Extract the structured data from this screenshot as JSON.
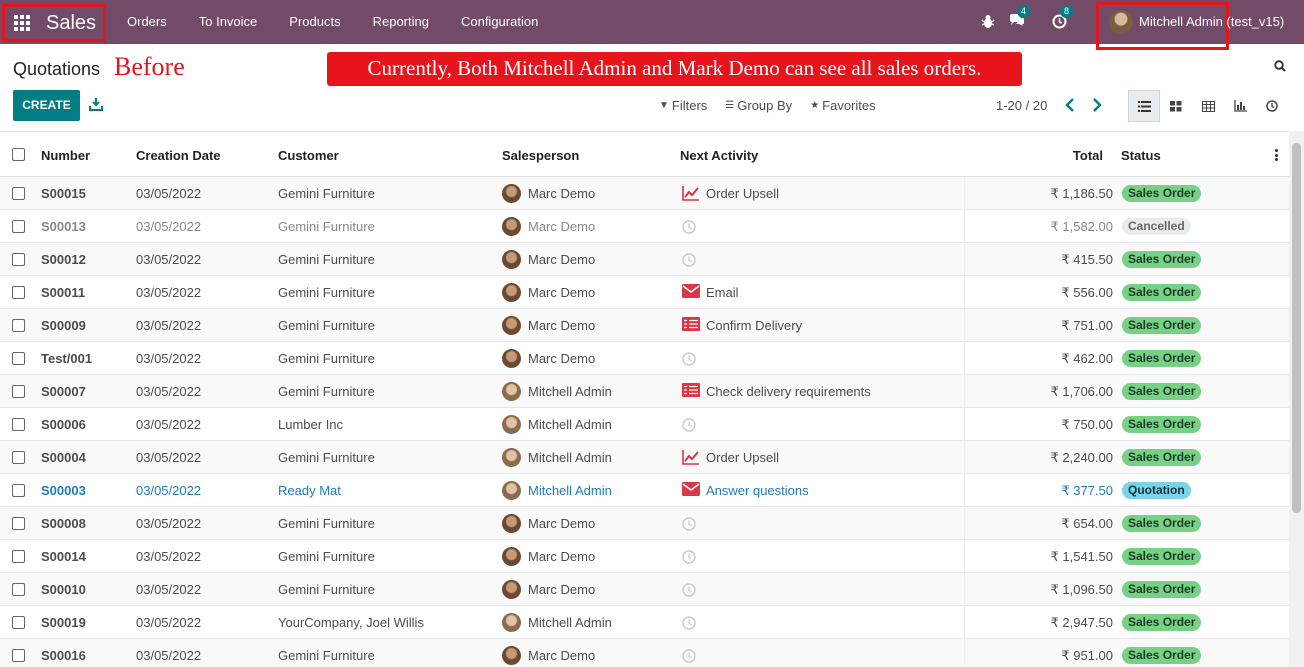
{
  "navbar": {
    "brand": "Sales",
    "menu": [
      "Orders",
      "To Invoice",
      "Products",
      "Reporting",
      "Configuration"
    ],
    "messages_count": "4",
    "activities_count": "8",
    "user": "Mitchell Admin (test_v15)"
  },
  "control_panel": {
    "title": "Quotations",
    "annotation_label": "Before",
    "banner": "Currently, Both Mitchell Admin and Mark Demo can see all sales orders.",
    "create_label": "CREATE",
    "filters_label": "Filters",
    "group_by_label": "Group By",
    "favorites_label": "Favorites",
    "pager": "1-20 / 20"
  },
  "table": {
    "headers": {
      "number": "Number",
      "creation_date": "Creation Date",
      "customer": "Customer",
      "salesperson": "Salesperson",
      "next_activity": "Next Activity",
      "total": "Total",
      "status": "Status"
    },
    "rows": [
      {
        "number": "S00015",
        "date": "03/05/2022",
        "customer": "Gemini Furniture",
        "salesperson": "Marc Demo",
        "activity": "Order Upsell",
        "activity_icon": "trend-icon",
        "total": "₹ 1,186.50",
        "status": "Sales Order",
        "kind": "sale"
      },
      {
        "number": "S00013",
        "date": "03/05/2022",
        "customer": "Gemini Furniture",
        "salesperson": "Marc Demo",
        "activity": "",
        "activity_icon": "clock-icon",
        "total": "₹ 1,582.00",
        "status": "Cancelled",
        "kind": "cancel"
      },
      {
        "number": "S00012",
        "date": "03/05/2022",
        "customer": "Gemini Furniture",
        "salesperson": "Marc Demo",
        "activity": "",
        "activity_icon": "clock-icon",
        "total": "₹ 415.50",
        "status": "Sales Order",
        "kind": "sale"
      },
      {
        "number": "S00011",
        "date": "03/05/2022",
        "customer": "Gemini Furniture",
        "salesperson": "Marc Demo",
        "activity": "Email",
        "activity_icon": "envelope-icon",
        "total": "₹ 556.00",
        "status": "Sales Order",
        "kind": "sale"
      },
      {
        "number": "S00009",
        "date": "03/05/2022",
        "customer": "Gemini Furniture",
        "salesperson": "Marc Demo",
        "activity": "Confirm Delivery",
        "activity_icon": "tasks-icon",
        "total": "₹ 751.00",
        "status": "Sales Order",
        "kind": "sale"
      },
      {
        "number": "Test/001",
        "date": "03/05/2022",
        "customer": "Gemini Furniture",
        "salesperson": "Marc Demo",
        "activity": "",
        "activity_icon": "clock-icon",
        "total": "₹ 462.00",
        "status": "Sales Order",
        "kind": "sale"
      },
      {
        "number": "S00007",
        "date": "03/05/2022",
        "customer": "Gemini Furniture",
        "salesperson": "Mitchell Admin",
        "activity": "Check delivery requirements",
        "activity_icon": "tasks-icon",
        "total": "₹ 1,706.00",
        "status": "Sales Order",
        "kind": "sale"
      },
      {
        "number": "S00006",
        "date": "03/05/2022",
        "customer": "Lumber Inc",
        "salesperson": "Mitchell Admin",
        "activity": "",
        "activity_icon": "clock-icon",
        "total": "₹ 750.00",
        "status": "Sales Order",
        "kind": "sale"
      },
      {
        "number": "S00004",
        "date": "03/05/2022",
        "customer": "Gemini Furniture",
        "salesperson": "Mitchell Admin",
        "activity": "Order Upsell",
        "activity_icon": "trend-icon",
        "total": "₹ 2,240.00",
        "status": "Sales Order",
        "kind": "sale"
      },
      {
        "number": "S00003",
        "date": "03/05/2022",
        "customer": "Ready Mat",
        "salesperson": "Mitchell Admin",
        "activity": "Answer questions",
        "activity_icon": "envelope-icon",
        "total": "₹ 377.50",
        "status": "Quotation",
        "kind": "quote"
      },
      {
        "number": "S00008",
        "date": "03/05/2022",
        "customer": "Gemini Furniture",
        "salesperson": "Marc Demo",
        "activity": "",
        "activity_icon": "clock-icon",
        "total": "₹ 654.00",
        "status": "Sales Order",
        "kind": "sale"
      },
      {
        "number": "S00014",
        "date": "03/05/2022",
        "customer": "Gemini Furniture",
        "salesperson": "Marc Demo",
        "activity": "",
        "activity_icon": "clock-icon",
        "total": "₹ 1,541.50",
        "status": "Sales Order",
        "kind": "sale"
      },
      {
        "number": "S00010",
        "date": "03/05/2022",
        "customer": "Gemini Furniture",
        "salesperson": "Marc Demo",
        "activity": "",
        "activity_icon": "clock-icon",
        "total": "₹ 1,096.50",
        "status": "Sales Order",
        "kind": "sale"
      },
      {
        "number": "S00019",
        "date": "03/05/2022",
        "customer": "YourCompany, Joel Willis",
        "salesperson": "Mitchell Admin",
        "activity": "",
        "activity_icon": "clock-icon",
        "total": "₹ 2,947.50",
        "status": "Sales Order",
        "kind": "sale"
      },
      {
        "number": "S00016",
        "date": "03/05/2022",
        "customer": "Gemini Furniture",
        "salesperson": "Marc Demo",
        "activity": "",
        "activity_icon": "clock-icon",
        "total": "₹ 951.00",
        "status": "Sales Order",
        "kind": "sale"
      }
    ]
  },
  "colors": {
    "navbar": "#714b67",
    "primary": "#017e84",
    "annotation_red": "#e8141c",
    "activity_red": "#dc3545",
    "sale_badge": "#77d185",
    "quote_badge": "#7cd3e8",
    "link_blue": "#1f7bbf"
  }
}
